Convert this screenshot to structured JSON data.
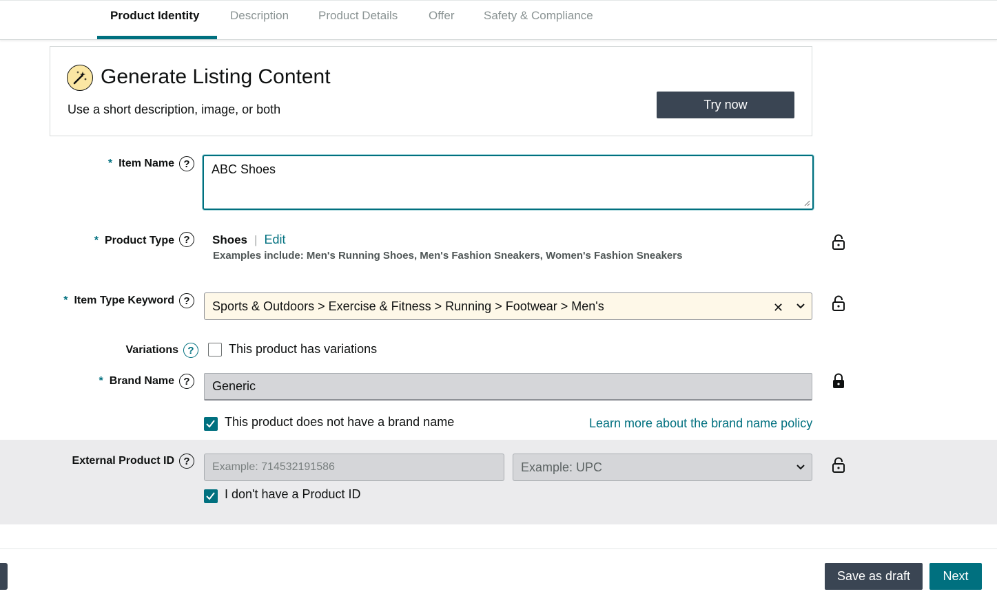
{
  "tabs": [
    {
      "label": "Product Identity",
      "active": true
    },
    {
      "label": "Description"
    },
    {
      "label": "Product Details"
    },
    {
      "label": "Offer"
    },
    {
      "label": "Safety & Compliance"
    }
  ],
  "generate": {
    "title": "Generate Listing Content",
    "subtitle": "Use a short description, image, or both",
    "button_label": "Try now",
    "icon": "magic-wand-icon"
  },
  "fields": {
    "item_name": {
      "label": "Item Name",
      "required_mark": "*",
      "value": "ABC Shoes"
    },
    "product_type": {
      "label": "Product Type",
      "required_mark": "*",
      "value": "Shoes",
      "separator": "|",
      "edit_label": "Edit",
      "examples": "Examples include: Men's Running Shoes, Men's Fashion Sneakers, Women's Fashion Sneakers"
    },
    "item_type_keyword": {
      "label": "Item Type Keyword",
      "required_mark": "*",
      "value": "Sports & Outdoors > Exercise & Fitness > Running > Footwear > Men's",
      "clear_glyph": "✕"
    },
    "variations": {
      "label": "Variations",
      "checkbox_label": "This product has variations",
      "checked": false
    },
    "brand_name": {
      "label": "Brand Name",
      "required_mark": "*",
      "value": "Generic",
      "checkbox_label": "This product does not have a brand name",
      "checked": true,
      "learn_more": "Learn more about the brand name policy"
    },
    "external_product_id": {
      "label": "External Product ID",
      "placeholder": "Example: 714532191586",
      "type_placeholder": "Example: UPC",
      "checkbox_label": "I don't have a Product ID",
      "checked": true
    }
  },
  "help_glyph": "?",
  "footer": {
    "save_draft_label": "Save as draft",
    "next_label": "Next"
  },
  "colors": {
    "accent": "#00707f",
    "dark_button": "#3a4553",
    "keyword_bg": "#fef8e8",
    "disabled_bg": "#d5d6d9"
  }
}
